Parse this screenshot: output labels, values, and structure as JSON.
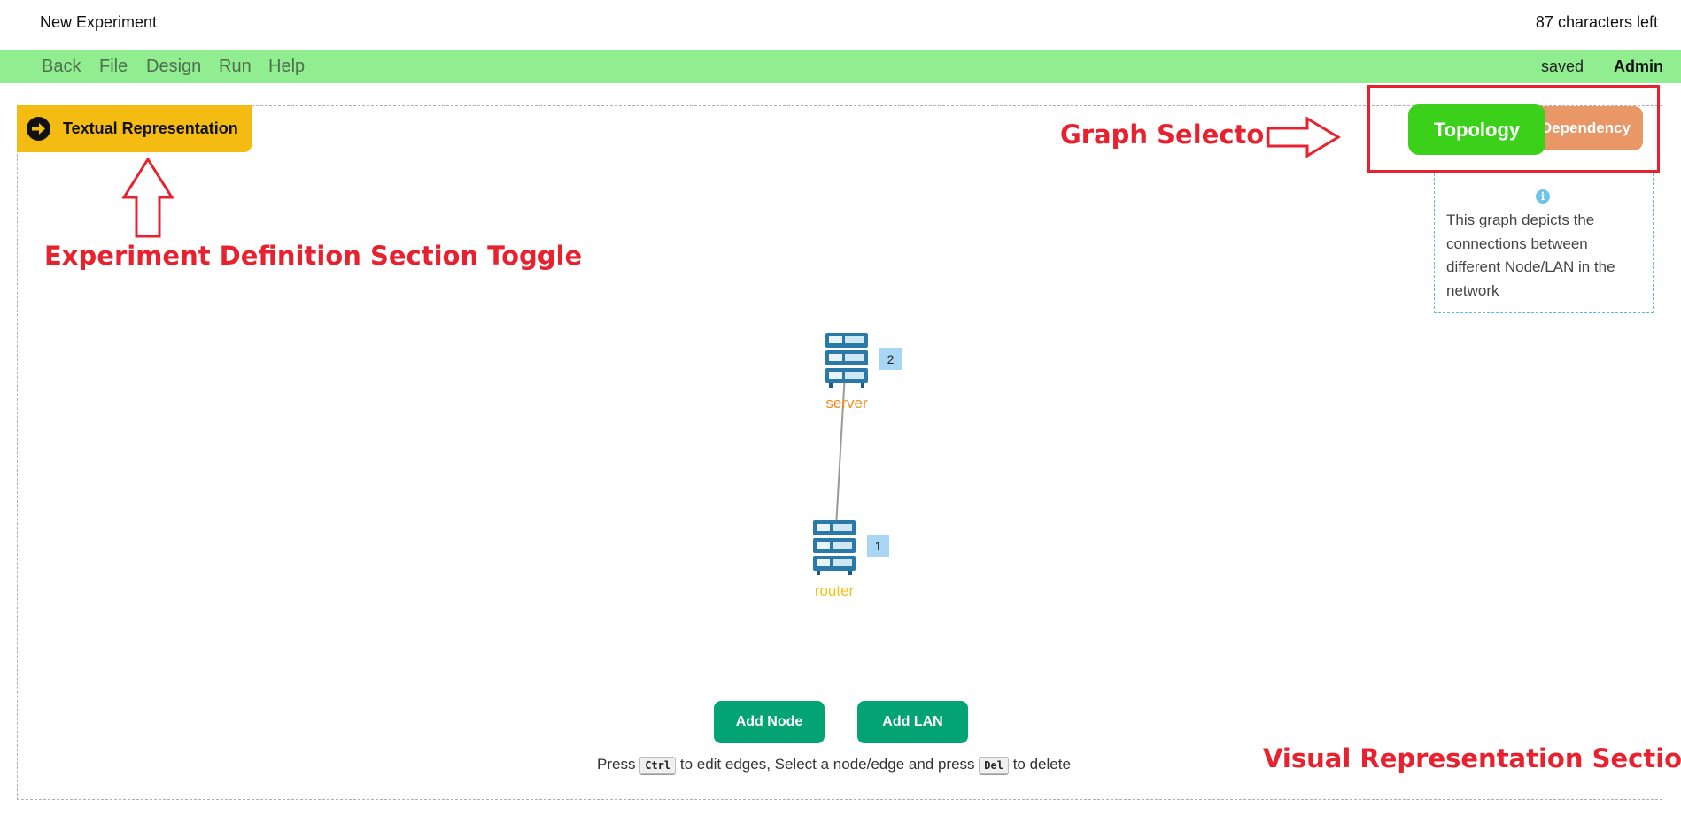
{
  "header": {
    "title": "New Experiment",
    "chars_left": "87 characters left"
  },
  "menu": {
    "items": [
      "Back",
      "File",
      "Design",
      "Run",
      "Help"
    ],
    "status": "saved",
    "user": "Admin"
  },
  "toggle": {
    "label": "Textual Representation",
    "icon": "arrow-right-circle-icon"
  },
  "annotations": {
    "graph_selector": "Graph Selector",
    "definition_toggle": "Experiment Definition Section Toggle",
    "visual_section": "Visual Representation Section"
  },
  "graph_selector": {
    "topology": "Topology",
    "dependency": "Dependency",
    "active": "Topology"
  },
  "info": {
    "icon": "info-icon",
    "text": "This graph depicts the connections between different Node/LAN in the network"
  },
  "nodes": [
    {
      "name": "server",
      "badge": "2",
      "color": "#f28b1e",
      "icon": "server-rack-icon"
    },
    {
      "name": "router",
      "badge": "1",
      "color": "#f3c316",
      "icon": "server-rack-icon"
    }
  ],
  "actions": {
    "add_node": "Add Node",
    "add_lan": "Add LAN"
  },
  "hint": {
    "press1": "Press",
    "key1": "Ctrl",
    "mid": "to edit edges, Select a node/edge and press",
    "key2": "Del",
    "end": "to delete"
  },
  "colors": {
    "menubar": "#90ee90",
    "toggle": "#f4bb12",
    "topology": "#3bd11b",
    "dependency": "#e99767",
    "action": "#04a374",
    "annotation": "#e8212f"
  }
}
